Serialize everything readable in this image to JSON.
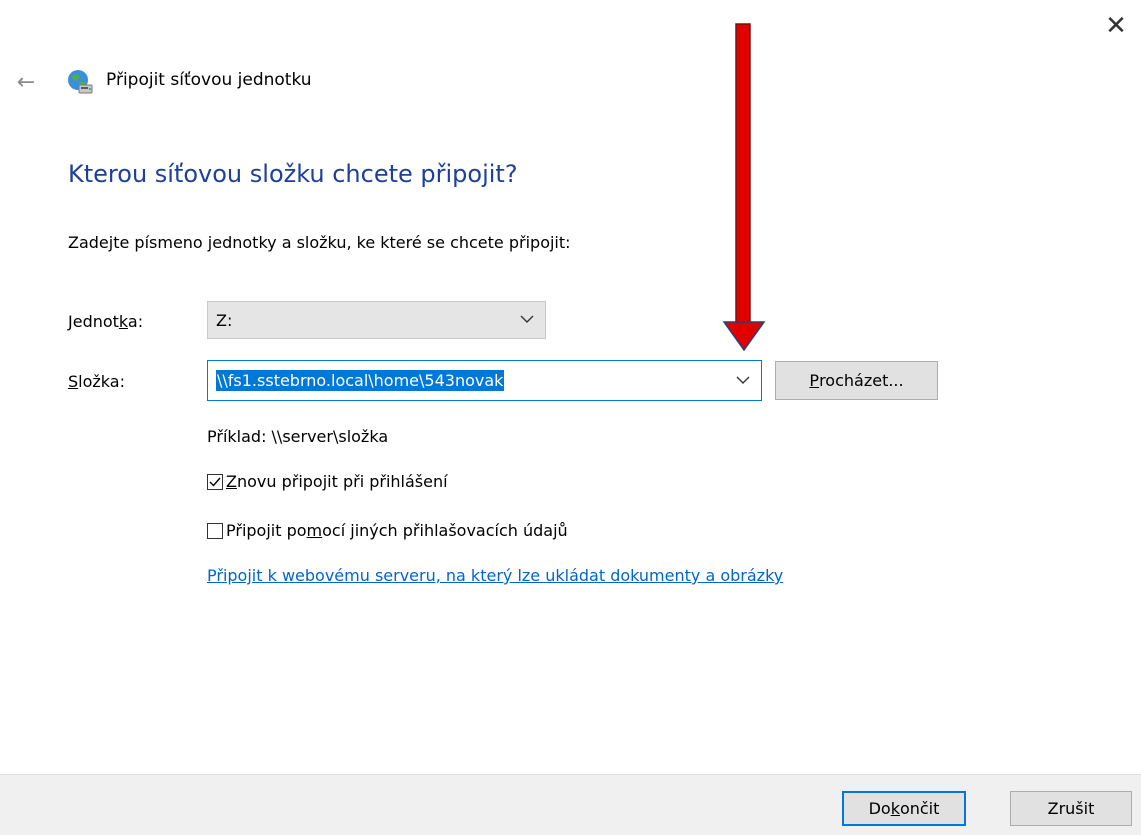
{
  "window": {
    "title": "Připojit síťovou jednotku",
    "close_glyph": "✕",
    "back_glyph": "←"
  },
  "icons": {
    "back": "back-arrow-icon",
    "title": "network-drive-icon",
    "close": "close-icon",
    "chevron": "chevron-down-icon",
    "annotation": "red-arrow-annotation"
  },
  "colors": {
    "heading": "#1e3f9a",
    "accent": "#0078d7",
    "link": "#0066cc",
    "annotation_arrow": "#e00000"
  },
  "main": {
    "heading": "Kterou síťovou složku chcete připojit?",
    "instruction": "Zadejte písmeno jednotky a složku, ke které se chcete připojit:",
    "drive_label": {
      "pre": "Jednot",
      "acc": "k",
      "post": "a:"
    },
    "drive_value": "Z:",
    "folder_label": {
      "pre": "",
      "acc": "S",
      "post": "ložka:"
    },
    "folder_value": "\\\\fs1.sstebrno.local\\home\\543novak",
    "browse_button": {
      "pre": "",
      "acc": "P",
      "post": "rocházet..."
    },
    "example": "Příklad: \\\\server\\složka",
    "reconnect": {
      "checked": true,
      "pre": "",
      "acc": "Z",
      "post": "novu připojit při přihlášení"
    },
    "other_credentials": {
      "checked": false,
      "pre": "Připojit po",
      "acc": "m",
      "post": "ocí jiných přihlašovacích údajů"
    },
    "web_link": "Připojit k webovému serveru, na který lze ukládat dokumenty a obrázky"
  },
  "footer": {
    "finish_button": {
      "pre": "Do",
      "acc": "k",
      "post": "ončit"
    },
    "cancel_button": "Zrušit"
  }
}
